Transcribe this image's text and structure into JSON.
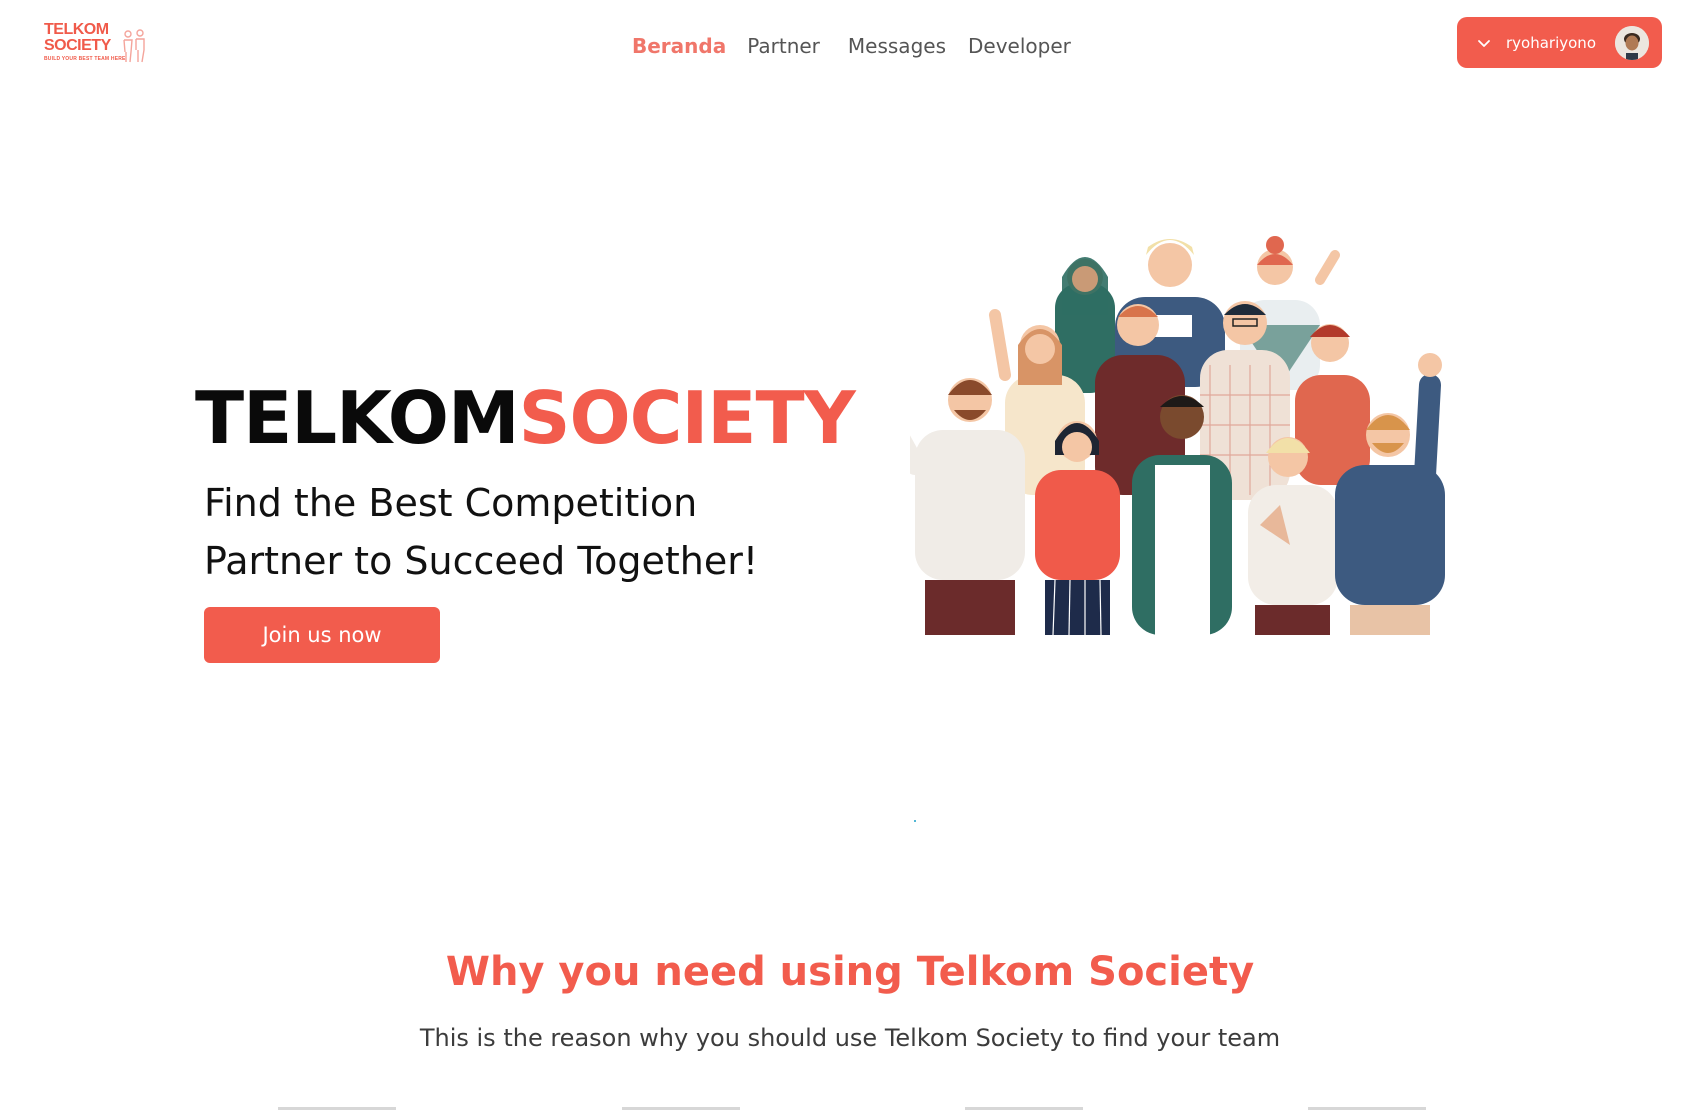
{
  "header": {
    "logo": {
      "line1": "TELKOM",
      "line2": "SOCIETY",
      "tagline": "BUILD YOUR BEST TEAM HERE"
    },
    "nav": [
      {
        "label": "Beranda",
        "active": true
      },
      {
        "label": "Partner",
        "active": false
      },
      {
        "label": "Messages",
        "active": false
      },
      {
        "label": "Developer",
        "active": false
      }
    ],
    "user": {
      "username": "ryohariyono",
      "icon": "chevron-down-icon"
    }
  },
  "hero": {
    "brand_part1": "TELKOM",
    "brand_part2": "SOCIETY",
    "tagline_line1": "Find the Best Competition",
    "tagline_line2": "Partner to Succeed Together!",
    "cta_label": "Join us now"
  },
  "why": {
    "title": "Why you need using Telkom Society",
    "subtitle": "This is the reason why you should use Telkom Society to find your team"
  },
  "colors": {
    "accent": "#f25c4d",
    "nav_active": "#f0766a",
    "text_dark": "#0a0a0a"
  }
}
